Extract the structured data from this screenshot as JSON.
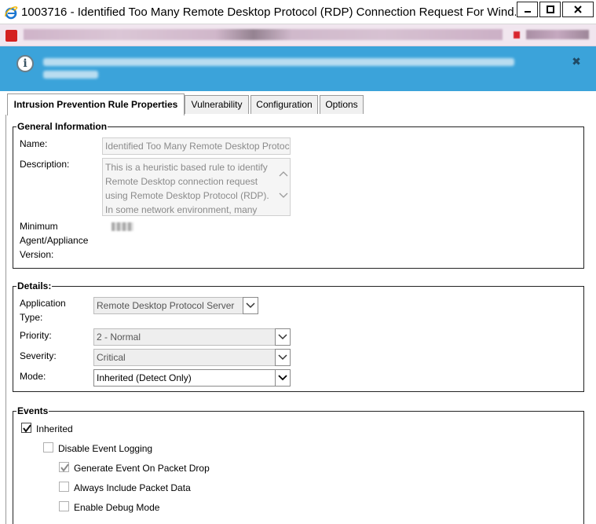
{
  "window": {
    "title": "1003716 - Identified Too Many Remote Desktop Protocol (RDP) Connection Request For Wind...",
    "minimize_label": "minimize",
    "maximize_label": "maximize",
    "close_label": "close"
  },
  "banner": {
    "icon": "info-icon",
    "message": "",
    "dismiss_icon": "close-icon"
  },
  "tabs": [
    {
      "label": "Intrusion Prevention Rule Properties",
      "active": true
    },
    {
      "label": "Vulnerability",
      "active": false
    },
    {
      "label": "Configuration",
      "active": false
    },
    {
      "label": "Options",
      "active": false
    }
  ],
  "general": {
    "legend": "General Information",
    "name_label": "Name:",
    "name_value": "Identified Too Many Remote Desktop Protocol",
    "description_label": "Description:",
    "description_value": "This is a heuristic based rule to identify Remote Desktop connection request using Remote Desktop Protocol (RDP). In some network environment, many",
    "min_version_label_1": "Minimum",
    "min_version_label_2": "Agent/Appliance",
    "min_version_label_3": "Version:"
  },
  "details": {
    "legend": "Details:",
    "app_type_label_1": "Application",
    "app_type_label_2": "Type:",
    "app_type_value": "Remote Desktop Protocol Server",
    "priority_label": "Priority:",
    "priority_value": "2 - Normal",
    "severity_label": "Severity:",
    "severity_value": "Critical",
    "mode_label": "Mode:",
    "mode_value": "Inherited (Detect Only)"
  },
  "events": {
    "legend": "Events",
    "inherited_label": "Inherited",
    "inherited_checked": true,
    "disable_logging_label": "Disable Event Logging",
    "disable_logging_checked": false,
    "generate_event_label": "Generate Event On Packet Drop",
    "generate_event_checked": true,
    "include_packet_label": "Always Include Packet Data",
    "include_packet_checked": false,
    "debug_mode_label": "Enable Debug Mode",
    "debug_mode_checked": false
  },
  "colors": {
    "banner_bg": "#3ba3da",
    "address_bar_bg": "#f1e6ef"
  }
}
